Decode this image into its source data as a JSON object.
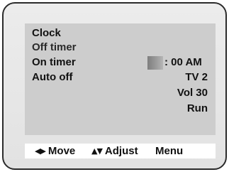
{
  "menu": {
    "rows": [
      {
        "label": "Clock",
        "value": ""
      },
      {
        "label": "Off timer",
        "value": ""
      },
      {
        "label": "On timer",
        "value": ": 00 AM"
      },
      {
        "label": "Auto off",
        "value": "TV 2"
      },
      {
        "label": "",
        "value": "Vol 30"
      },
      {
        "label": "",
        "value": "Run"
      }
    ]
  },
  "help": {
    "move": {
      "icon": "left-right-arrows-icon",
      "glyph": "◀▶",
      "label": "Move"
    },
    "adjust": {
      "icon": "up-down-arrows-icon",
      "glyph": "▲▼",
      "label": "Adjust"
    },
    "menu": {
      "label": "Menu"
    }
  },
  "colors": {
    "panel": "#cdcdcd",
    "frame": "#e6e6e6",
    "help_bar": "#ffffff",
    "text": "#111111"
  }
}
